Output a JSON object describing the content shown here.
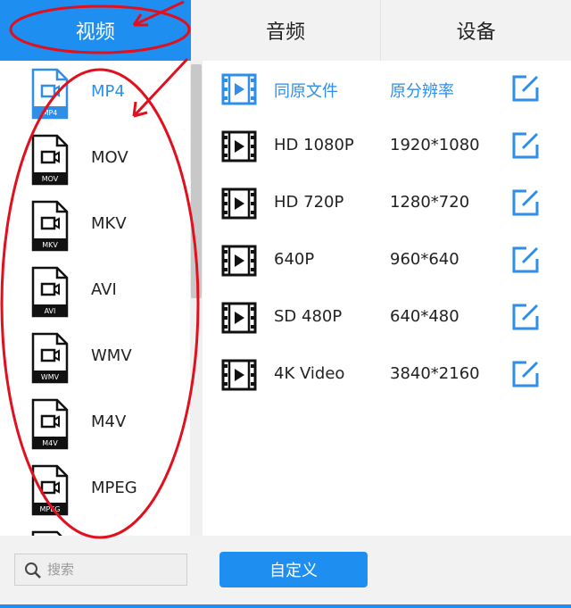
{
  "tabs": [
    {
      "label": "视频",
      "active": true
    },
    {
      "label": "音频",
      "active": false
    },
    {
      "label": "设备",
      "active": false
    }
  ],
  "formats": [
    {
      "label": "MP4",
      "badge": "MP4",
      "active": true
    },
    {
      "label": "MOV",
      "badge": "MOV",
      "active": false
    },
    {
      "label": "MKV",
      "badge": "MKV",
      "active": false
    },
    {
      "label": "AVI",
      "badge": "AVI",
      "active": false
    },
    {
      "label": "WMV",
      "badge": "WMV",
      "active": false
    },
    {
      "label": "M4V",
      "badge": "M4V",
      "active": false
    },
    {
      "label": "MPEG",
      "badge": "MPEG",
      "active": false
    }
  ],
  "presets": [
    {
      "name": "同原文件",
      "resolution": "原分辨率",
      "active": true
    },
    {
      "name": "HD 1080P",
      "resolution": "1920*1080",
      "active": false
    },
    {
      "name": "HD 720P",
      "resolution": "1280*720",
      "active": false
    },
    {
      "name": "640P",
      "resolution": "960*640",
      "active": false
    },
    {
      "name": "SD 480P",
      "resolution": "640*480",
      "active": false
    },
    {
      "name": "4K Video",
      "resolution": "3840*2160",
      "active": false
    }
  ],
  "search": {
    "placeholder": "搜索",
    "value": ""
  },
  "custom_button": "自定义",
  "colors": {
    "accent": "#1e8ff0",
    "active_text": "#2f8ee8",
    "annotation": "#e0101e"
  },
  "icons": {
    "format": "video-file-icon",
    "preset": "film-icon",
    "edit": "edit-icon",
    "search": "search-icon"
  }
}
